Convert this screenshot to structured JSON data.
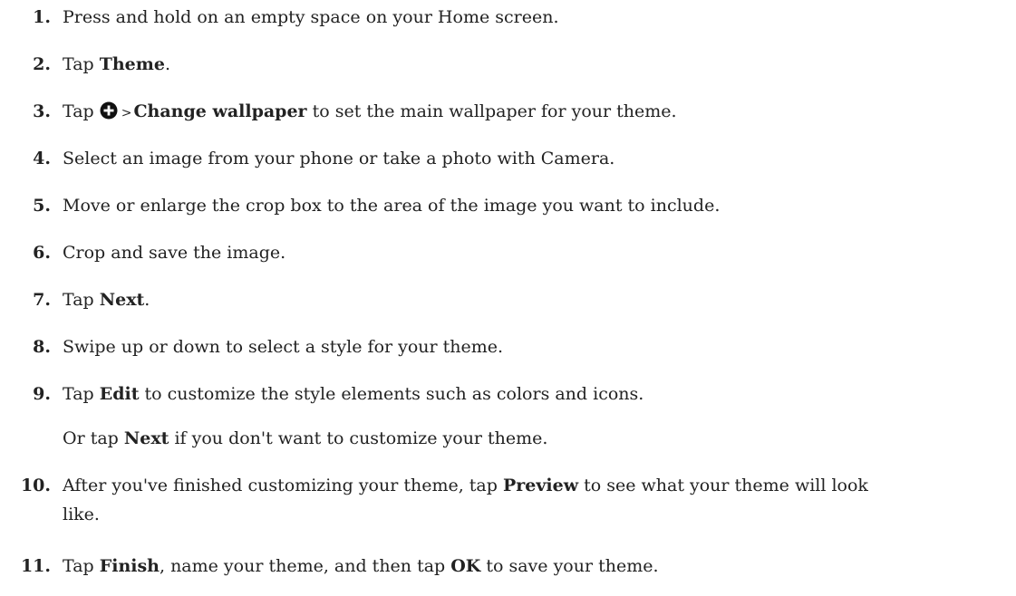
{
  "steps": [
    {
      "num": "1.",
      "parts": [
        {
          "t": "Press and hold on an empty space on your Home screen."
        }
      ]
    },
    {
      "num": "2.",
      "parts": [
        {
          "t": "Tap "
        },
        {
          "b": "Theme"
        },
        {
          "t": "."
        }
      ]
    },
    {
      "num": "3.",
      "a": "Tap",
      "gt": ">",
      "b": "Change wallpaper",
      "c": " to set the main wallpaper for your theme.",
      "icon": "plus-circle-icon"
    },
    {
      "num": "4.",
      "parts": [
        {
          "t": "Select an image from your phone or take a photo with Camera."
        }
      ]
    },
    {
      "num": "5.",
      "parts": [
        {
          "t": "Move or enlarge the crop box to the area of the image you want to include."
        }
      ]
    },
    {
      "num": "6.",
      "parts": [
        {
          "t": "Crop and save the image."
        }
      ]
    },
    {
      "num": "7.",
      "parts": [
        {
          "t": "Tap "
        },
        {
          "b": "Next"
        },
        {
          "t": "."
        }
      ]
    },
    {
      "num": "8.",
      "parts": [
        {
          "t": "Swipe up or down to select a style for your theme."
        }
      ]
    },
    {
      "num": "9.",
      "parts": [
        {
          "t": "Tap "
        },
        {
          "b": "Edit"
        },
        {
          "t": " to customize the style elements such as colors and icons."
        }
      ]
    },
    {
      "num": "10.",
      "parts": [
        {
          "t": "After you've finished customizing your theme, tap "
        },
        {
          "b": "Preview"
        },
        {
          "t": " to see what your theme will look like."
        }
      ]
    },
    {
      "num": "11.",
      "parts": [
        {
          "t": "Tap "
        },
        {
          "b": "Finish"
        },
        {
          "t": ", name your theme, and then tap "
        },
        {
          "b": "OK"
        },
        {
          "t": " to save your theme."
        }
      ]
    }
  ],
  "note": {
    "a": "Or tap ",
    "b": "Next",
    "c": " if you don't want to customize your theme."
  }
}
